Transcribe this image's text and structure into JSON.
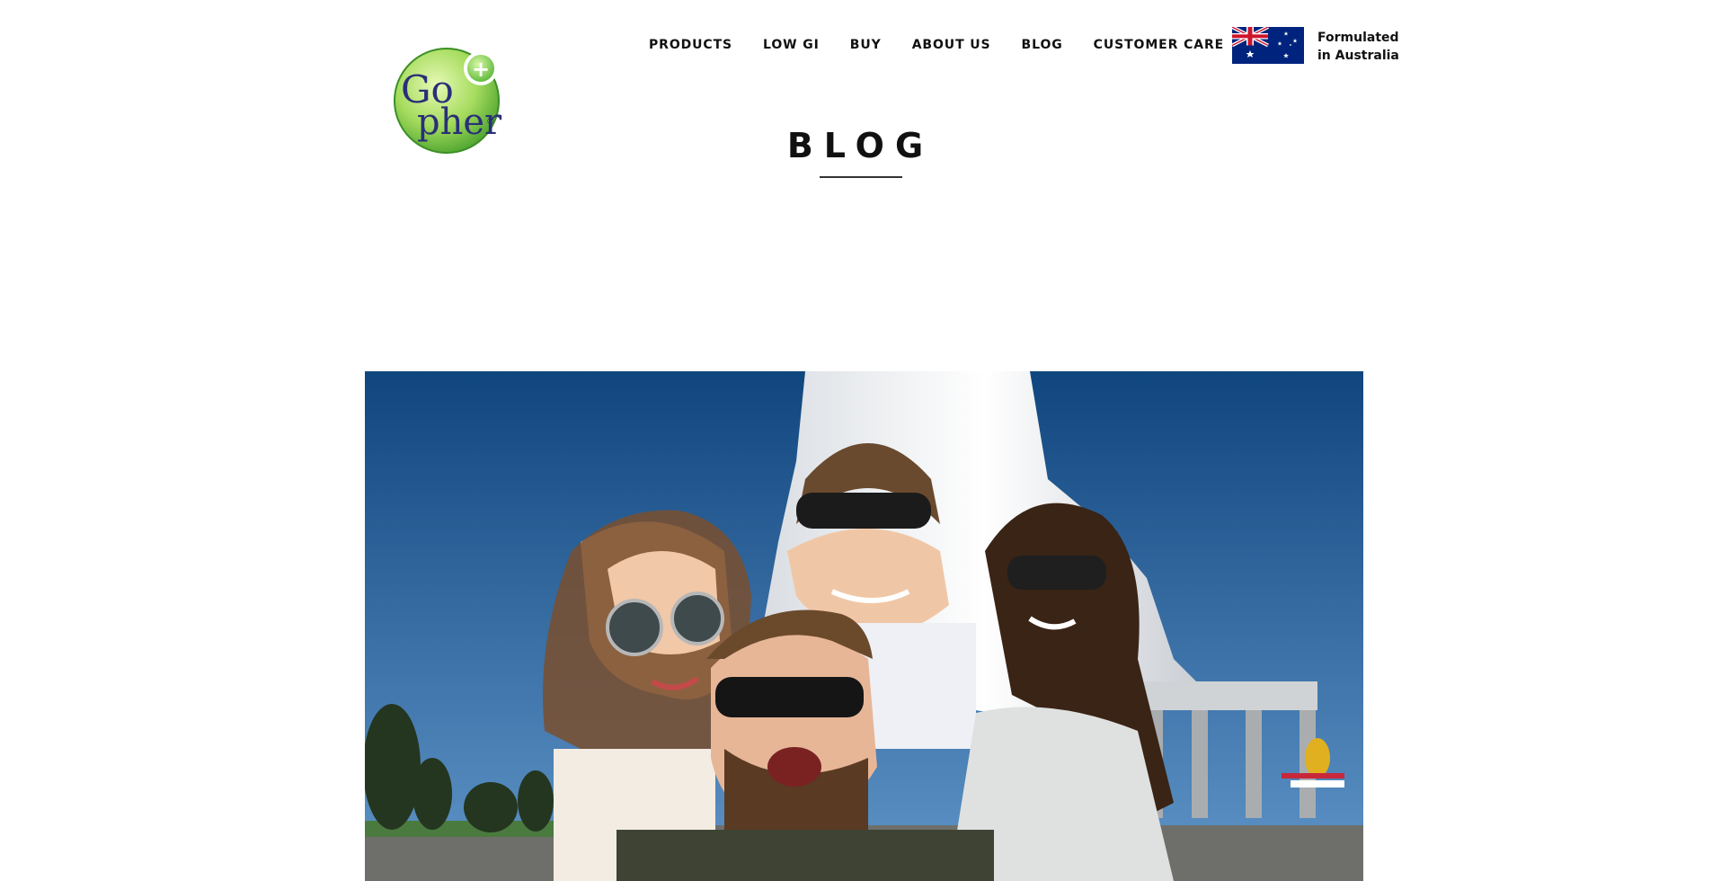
{
  "brand": {
    "logo_line1": "Go",
    "logo_line2": "pher",
    "logo_mark": "®",
    "logo_badge": "+"
  },
  "nav": {
    "items": [
      {
        "label": "PRODUCTS"
      },
      {
        "label": "LOW GI"
      },
      {
        "label": "BUY"
      },
      {
        "label": "ABOUT US"
      },
      {
        "label": "BLOG"
      },
      {
        "label": "CUSTOMER CARE"
      }
    ]
  },
  "origin": {
    "flag_icon": "australian-flag-icon",
    "line1": "Formulated",
    "line2": "in Australia"
  },
  "page": {
    "title": "BLOG"
  },
  "hero": {
    "icon": "group-selfie-photo"
  },
  "colors": {
    "logo_green_light": "#c6ec8a",
    "logo_green_dark": "#4aa22e",
    "logo_text": "#2a2f78",
    "flag_blue": "#00247d",
    "flag_red": "#cf142b",
    "sky_top": "#10467e",
    "sky_bottom": "#5f95c8"
  }
}
